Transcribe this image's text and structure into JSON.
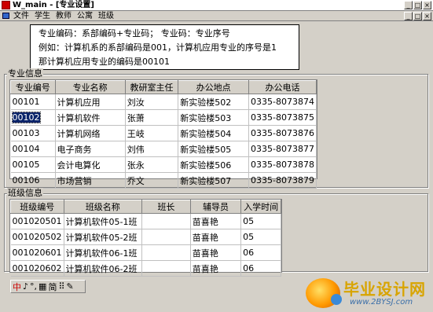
{
  "window": {
    "title": "W_main - [专业设置]",
    "controls": [
      "_",
      "□",
      "×"
    ]
  },
  "menu": {
    "items": [
      "文件",
      "学生",
      "教师",
      "公寓",
      "班级"
    ],
    "mdi_controls": [
      "_",
      "□",
      "×"
    ]
  },
  "note": {
    "lines": [
      "专业编码：系部编码+专业码；  专业码：专业序号",
      "例如：计算机系的系部编码是001，计算机应用专业的序号是1",
      "那计算机应用专业的编码是00101"
    ]
  },
  "major_group": {
    "label": "专业信息",
    "columns": [
      "专业编号",
      "专业名称",
      "教研室主任",
      "办公地点",
      "办公电话"
    ],
    "selected_row": 1,
    "rows": [
      [
        "00101",
        "计算机应用",
        "刘汝",
        "新实验楼502",
        "0335-8073874"
      ],
      [
        "00102",
        "计算机软件",
        "张萧",
        "新实验楼503",
        "0335-8073875"
      ],
      [
        "00103",
        "计算机网络",
        "王岐",
        "新实验楼504",
        "0335-8073876"
      ],
      [
        "00104",
        "电子商务",
        "刘伟",
        "新实验楼505",
        "0335-8073877"
      ],
      [
        "00105",
        "会计电算化",
        "张永",
        "新实验楼506",
        "0335-8073878"
      ],
      [
        "00106",
        "市场营销",
        "乔文",
        "新实验楼507",
        "0335-8073879"
      ]
    ]
  },
  "class_group": {
    "label": "班级信息",
    "columns": [
      "班级编号",
      "班级名称",
      "班长",
      "辅导员",
      "入学时间"
    ],
    "rows": [
      [
        "001020501",
        "计算机软件05-1班",
        "",
        "苗喜艳",
        "05"
      ],
      [
        "001020502",
        "计算机软件05-2班",
        "",
        "苗喜艳",
        "05"
      ],
      [
        "001020601",
        "计算机软件06-1班",
        "",
        "苗喜艳",
        "06"
      ],
      [
        "001020602",
        "计算机软件06-2班",
        "",
        "苗喜艳",
        "06"
      ]
    ]
  },
  "ime": {
    "items": [
      "中",
      "♪",
      "°,",
      "▦",
      "简",
      "⠿",
      "✎"
    ]
  },
  "watermark": {
    "text": "毕业设计网",
    "url": "www.2BYSJ.com"
  }
}
